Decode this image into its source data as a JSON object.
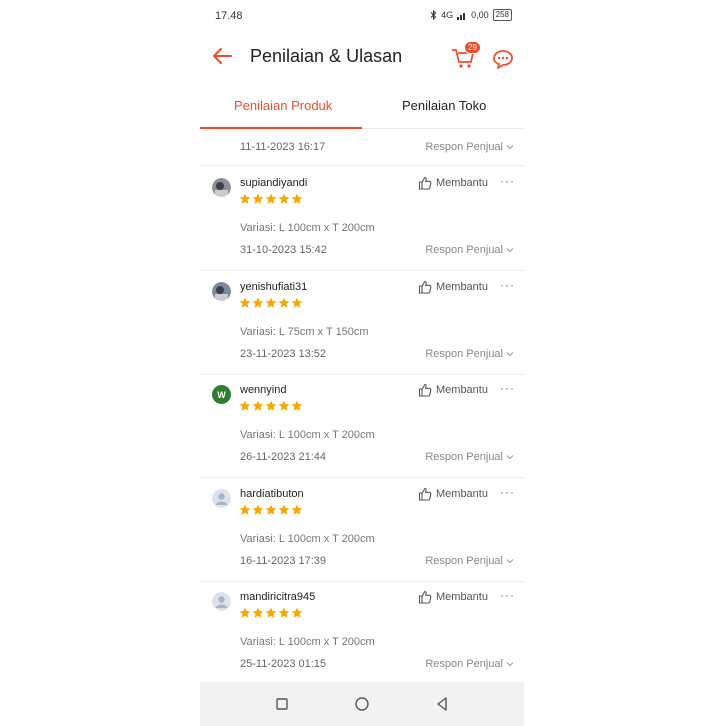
{
  "status_bar": {
    "time": "17.48",
    "signal": "4G",
    "data_rate": "0,00",
    "battery": "258"
  },
  "header": {
    "title": "Penilaian & Ulasan",
    "cart_badge": "29"
  },
  "tabs": [
    {
      "label": "Penilaian Produk",
      "active": true
    },
    {
      "label": "Penilaian Toko",
      "active": false
    }
  ],
  "top_row": {
    "date": "11-11-2023 16:17",
    "respon_label": "Respon Penjual"
  },
  "reviews": [
    {
      "username": "supiandiyandi",
      "rating": 5,
      "variant": "Variasi: L 100cm x T 200cm",
      "date": "31-10-2023 15:42",
      "helpful_label": "Membantu",
      "respon_label": "Respon Penjual"
    },
    {
      "username": "yenishufiati31",
      "rating": 5,
      "variant": "Variasi: L 75cm x T 150cm",
      "date": "23-11-2023 13:52",
      "helpful_label": "Membantu",
      "respon_label": "Respon Penjual"
    },
    {
      "username": "wennyind",
      "avatar_letter": "W",
      "rating": 5,
      "variant": "Variasi: L 100cm x T 200cm",
      "date": "26-11-2023 21:44",
      "helpful_label": "Membantu",
      "respon_label": "Respon Penjual"
    },
    {
      "username": "hardiatibuton",
      "rating": 5,
      "variant": "Variasi: L 100cm x T 200cm",
      "date": "16-11-2023 17:39",
      "helpful_label": "Membantu",
      "respon_label": "Respon Penjual"
    },
    {
      "username": "mandiricitra945",
      "rating": 5,
      "variant": "Variasi: L 100cm x T 200cm",
      "date": "25-11-2023 01:15",
      "helpful_label": "Membantu",
      "respon_label": "Respon Penjual"
    }
  ],
  "more_glyph": "···",
  "colors": {
    "accent": "#ee4d2d",
    "star": "#f6a700",
    "avatar_green": "#2e7d32"
  },
  "icons": [
    "back-arrow-icon",
    "cart-icon",
    "chat-icon",
    "thumbs-up-icon",
    "more-icon",
    "chevron-down-icon",
    "star-icon",
    "nav-square-icon",
    "nav-circle-icon",
    "nav-back-icon"
  ]
}
